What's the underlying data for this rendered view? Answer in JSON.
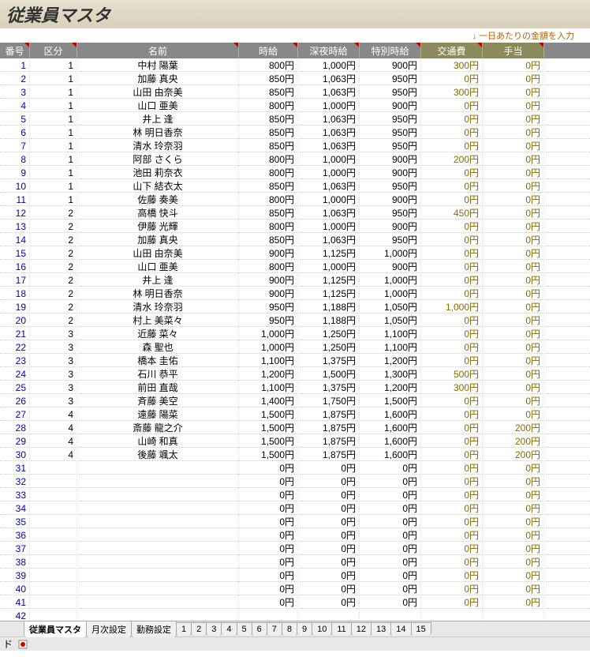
{
  "title": "従業員マスタ",
  "note": "↓ 一日あたりの金額を入力",
  "headers": {
    "no": "番号",
    "kubun": "区分",
    "name": "名前",
    "wage": "時給",
    "night": "深夜時給",
    "special": "特別時給",
    "trans": "交通費",
    "allow": "手当"
  },
  "rows": [
    {
      "no": "1",
      "k": "1",
      "name": "中村 陽葉",
      "w": "800円",
      "n": "1,000円",
      "s": "900円",
      "t": "300円",
      "a": "0円"
    },
    {
      "no": "2",
      "k": "1",
      "name": "加藤 真央",
      "w": "850円",
      "n": "1,063円",
      "s": "950円",
      "t": "0円",
      "a": "0円"
    },
    {
      "no": "3",
      "k": "1",
      "name": "山田 由奈美",
      "w": "850円",
      "n": "1,063円",
      "s": "950円",
      "t": "300円",
      "a": "0円"
    },
    {
      "no": "4",
      "k": "1",
      "name": "山口 亜美",
      "w": "800円",
      "n": "1,000円",
      "s": "900円",
      "t": "0円",
      "a": "0円"
    },
    {
      "no": "5",
      "k": "1",
      "name": "井上 逢",
      "w": "850円",
      "n": "1,063円",
      "s": "950円",
      "t": "0円",
      "a": "0円"
    },
    {
      "no": "6",
      "k": "1",
      "name": "林 明日香奈",
      "w": "850円",
      "n": "1,063円",
      "s": "950円",
      "t": "0円",
      "a": "0円"
    },
    {
      "no": "7",
      "k": "1",
      "name": "清水 玲奈羽",
      "w": "850円",
      "n": "1,063円",
      "s": "950円",
      "t": "0円",
      "a": "0円"
    },
    {
      "no": "8",
      "k": "1",
      "name": "阿部 さくら",
      "w": "800円",
      "n": "1,000円",
      "s": "900円",
      "t": "200円",
      "a": "0円"
    },
    {
      "no": "9",
      "k": "1",
      "name": "池田 莉奈衣",
      "w": "800円",
      "n": "1,000円",
      "s": "900円",
      "t": "0円",
      "a": "0円"
    },
    {
      "no": "10",
      "k": "1",
      "name": "山下 結衣太",
      "w": "850円",
      "n": "1,063円",
      "s": "950円",
      "t": "0円",
      "a": "0円"
    },
    {
      "no": "11",
      "k": "1",
      "name": "佐藤 奏美",
      "w": "800円",
      "n": "1,000円",
      "s": "900円",
      "t": "0円",
      "a": "0円"
    },
    {
      "no": "12",
      "k": "2",
      "name": "高橋 快斗",
      "w": "850円",
      "n": "1,063円",
      "s": "950円",
      "t": "450円",
      "a": "0円"
    },
    {
      "no": "13",
      "k": "2",
      "name": "伊藤 光輝",
      "w": "800円",
      "n": "1,000円",
      "s": "900円",
      "t": "0円",
      "a": "0円"
    },
    {
      "no": "14",
      "k": "2",
      "name": "加藤 真央",
      "w": "850円",
      "n": "1,063円",
      "s": "950円",
      "t": "0円",
      "a": "0円"
    },
    {
      "no": "15",
      "k": "2",
      "name": "山田 由奈美",
      "w": "900円",
      "n": "1,125円",
      "s": "1,000円",
      "t": "0円",
      "a": "0円"
    },
    {
      "no": "16",
      "k": "2",
      "name": "山口 亜美",
      "w": "800円",
      "n": "1,000円",
      "s": "900円",
      "t": "0円",
      "a": "0円"
    },
    {
      "no": "17",
      "k": "2",
      "name": "井上 逢",
      "w": "900円",
      "n": "1,125円",
      "s": "1,000円",
      "t": "0円",
      "a": "0円"
    },
    {
      "no": "18",
      "k": "2",
      "name": "林 明日香奈",
      "w": "900円",
      "n": "1,125円",
      "s": "1,000円",
      "t": "0円",
      "a": "0円"
    },
    {
      "no": "19",
      "k": "2",
      "name": "清水 玲奈羽",
      "w": "950円",
      "n": "1,188円",
      "s": "1,050円",
      "t": "1,000円",
      "a": "0円"
    },
    {
      "no": "20",
      "k": "2",
      "name": "村上 美菜々",
      "w": "950円",
      "n": "1,188円",
      "s": "1,050円",
      "t": "0円",
      "a": "0円"
    },
    {
      "no": "21",
      "k": "3",
      "name": "近藤 菜々",
      "w": "1,000円",
      "n": "1,250円",
      "s": "1,100円",
      "t": "0円",
      "a": "0円"
    },
    {
      "no": "22",
      "k": "3",
      "name": "森 聖也",
      "w": "1,000円",
      "n": "1,250円",
      "s": "1,100円",
      "t": "0円",
      "a": "0円"
    },
    {
      "no": "23",
      "k": "3",
      "name": "橋本 圭佑",
      "w": "1,100円",
      "n": "1,375円",
      "s": "1,200円",
      "t": "0円",
      "a": "0円"
    },
    {
      "no": "24",
      "k": "3",
      "name": "石川 恭平",
      "w": "1,200円",
      "n": "1,500円",
      "s": "1,300円",
      "t": "500円",
      "a": "0円"
    },
    {
      "no": "25",
      "k": "3",
      "name": "前田 直哉",
      "w": "1,100円",
      "n": "1,375円",
      "s": "1,200円",
      "t": "300円",
      "a": "0円"
    },
    {
      "no": "26",
      "k": "3",
      "name": "斉藤 美空",
      "w": "1,400円",
      "n": "1,750円",
      "s": "1,500円",
      "t": "0円",
      "a": "0円"
    },
    {
      "no": "27",
      "k": "4",
      "name": "遠藤 陽菜",
      "w": "1,500円",
      "n": "1,875円",
      "s": "1,600円",
      "t": "0円",
      "a": "0円"
    },
    {
      "no": "28",
      "k": "4",
      "name": "斎藤 龍之介",
      "w": "1,500円",
      "n": "1,875円",
      "s": "1,600円",
      "t": "0円",
      "a": "200円"
    },
    {
      "no": "29",
      "k": "4",
      "name": "山崎 和真",
      "w": "1,500円",
      "n": "1,875円",
      "s": "1,600円",
      "t": "0円",
      "a": "200円"
    },
    {
      "no": "30",
      "k": "4",
      "name": "後藤 颯太",
      "w": "1,500円",
      "n": "1,875円",
      "s": "1,600円",
      "t": "0円",
      "a": "200円"
    },
    {
      "no": "31",
      "k": "",
      "name": "",
      "w": "0円",
      "n": "0円",
      "s": "0円",
      "t": "0円",
      "a": "0円"
    },
    {
      "no": "32",
      "k": "",
      "name": "",
      "w": "0円",
      "n": "0円",
      "s": "0円",
      "t": "0円",
      "a": "0円"
    },
    {
      "no": "33",
      "k": "",
      "name": "",
      "w": "0円",
      "n": "0円",
      "s": "0円",
      "t": "0円",
      "a": "0円"
    },
    {
      "no": "34",
      "k": "",
      "name": "",
      "w": "0円",
      "n": "0円",
      "s": "0円",
      "t": "0円",
      "a": "0円"
    },
    {
      "no": "35",
      "k": "",
      "name": "",
      "w": "0円",
      "n": "0円",
      "s": "0円",
      "t": "0円",
      "a": "0円"
    },
    {
      "no": "36",
      "k": "",
      "name": "",
      "w": "0円",
      "n": "0円",
      "s": "0円",
      "t": "0円",
      "a": "0円"
    },
    {
      "no": "37",
      "k": "",
      "name": "",
      "w": "0円",
      "n": "0円",
      "s": "0円",
      "t": "0円",
      "a": "0円"
    },
    {
      "no": "38",
      "k": "",
      "name": "",
      "w": "0円",
      "n": "0円",
      "s": "0円",
      "t": "0円",
      "a": "0円"
    },
    {
      "no": "39",
      "k": "",
      "name": "",
      "w": "0円",
      "n": "0円",
      "s": "0円",
      "t": "0円",
      "a": "0円"
    },
    {
      "no": "40",
      "k": "",
      "name": "",
      "w": "0円",
      "n": "0円",
      "s": "0円",
      "t": "0円",
      "a": "0円"
    },
    {
      "no": "41",
      "k": "",
      "name": "",
      "w": "0円",
      "n": "0円",
      "s": "0円",
      "t": "0円",
      "a": "0円"
    },
    {
      "no": "42",
      "k": "",
      "name": "",
      "w": "",
      "n": "",
      "s": "",
      "t": "",
      "a": ""
    }
  ],
  "tabs": [
    "従業員マスタ",
    "月次設定",
    "勤務設定",
    "1",
    "2",
    "3",
    "4",
    "5",
    "6",
    "7",
    "8",
    "9",
    "10",
    "11",
    "12",
    "13",
    "14",
    "15"
  ],
  "active_tab": 0,
  "status": {
    "label": "ド"
  }
}
